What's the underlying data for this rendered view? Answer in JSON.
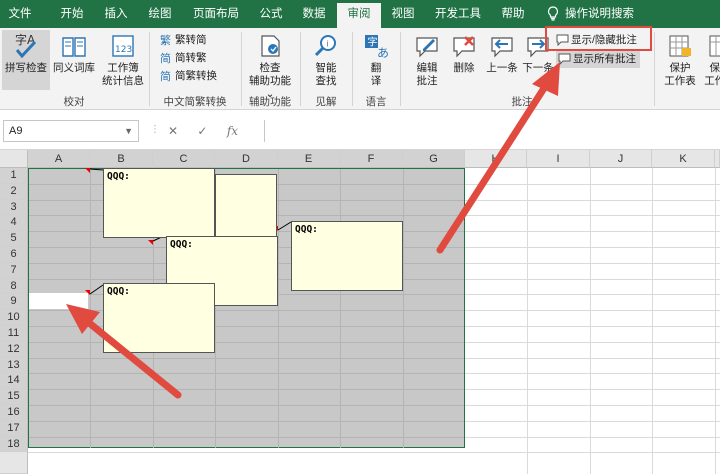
{
  "tabs": [
    "文件",
    "开始",
    "插入",
    "绘图",
    "页面布局",
    "公式",
    "数据",
    "审阅",
    "视图",
    "开发工具",
    "帮助",
    "操作说明搜索"
  ],
  "ribbon": {
    "spelling": "拼写检查",
    "thesaurus": "同义词库",
    "workbook_stats_1": "工作簿",
    "workbook_stats_2": "统计信息",
    "group_proofing": "校对",
    "to_traditional": "繁转简",
    "to_simplified": "简转繁",
    "convert": "简繁转换",
    "group_chinese": "中文简繁转换",
    "check_1": "检查",
    "check_2": "辅助功能",
    "group_accessibility": "辅助功能",
    "smart_1": "智能",
    "smart_2": "查找",
    "group_insights": "见解",
    "translate_1": "翻",
    "translate_2": "译",
    "group_language": "语言",
    "edit_note_1": "编辑",
    "edit_note_2": "批注",
    "delete": "删除",
    "previous": "上一条",
    "next": "下一条",
    "show_hide_note": "显示/隐藏批注",
    "show_all_notes": "显示所有批注",
    "group_notes": "批注",
    "protect_sheet_1": "保护",
    "protect_sheet_2": "工作表",
    "protect_wb_1": "保护",
    "protect_wb_2": "工作簿"
  },
  "formula_bar": {
    "name_box": "A9",
    "fx": "fx",
    "cancel": "✕",
    "enter": "✓"
  },
  "columns": [
    "A",
    "B",
    "C",
    "D",
    "E",
    "F",
    "G",
    "H",
    "I",
    "J",
    "K"
  ],
  "rows": [
    "1",
    "2",
    "3",
    "4",
    "5",
    "6",
    "7",
    "8",
    "9",
    "10",
    "11",
    "12",
    "13",
    "14",
    "15",
    "16",
    "17",
    "18"
  ],
  "notes": [
    {
      "text": "QQQ:"
    },
    {
      "text": "QQQ:"
    },
    {
      "text": "QQQ:"
    },
    {
      "text": "QQQ:"
    }
  ],
  "colors": {
    "excel_green": "#217346",
    "annotation_red": "#e04a3f",
    "note_fill": "#ffffe1"
  }
}
